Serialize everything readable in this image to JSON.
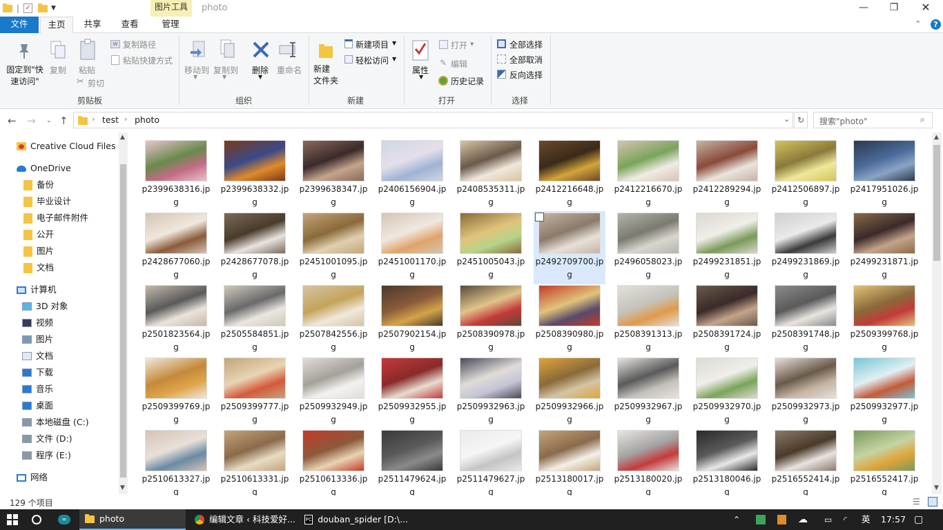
{
  "window": {
    "title": "photo",
    "context_tab": "图片工具",
    "minimize_icon": "minimize-icon",
    "restore_icon": "restore-icon",
    "close_icon": "close-icon"
  },
  "ribbon_tabs": {
    "file": "文件",
    "home": "主页",
    "share": "共享",
    "view": "查看",
    "manage": "管理"
  },
  "ribbon": {
    "pin_label": "固定到\"快速访问\"",
    "copy": "复制",
    "paste": "粘贴",
    "copy_path": "复制路径",
    "paste_shortcut": "粘贴快捷方式",
    "cut": "剪切",
    "clipboard_group": "剪贴板",
    "move_to": "移动到",
    "copy_to": "复制到",
    "delete": "删除",
    "rename": "重命名",
    "organize_group": "组织",
    "new_item": "新建项目",
    "easy_access": "轻松访问",
    "new_folder": "新建\n文件夹",
    "new_group": "新建",
    "properties": "属性",
    "open": "打开",
    "edit": "编辑",
    "history": "历史记录",
    "open_group": "打开",
    "select_all": "全部选择",
    "select_none": "全部取消",
    "invert_selection": "反向选择",
    "select_group": "选择"
  },
  "address": {
    "crumbs": [
      "test",
      "photo"
    ],
    "search_placeholder": "搜索\"photo\""
  },
  "nav_pane": {
    "creative_cloud": "Creative Cloud Files",
    "onedrive": "OneDrive",
    "onedrive_items": [
      "备份",
      "毕业设计",
      "电子邮件附件",
      "公开",
      "图片",
      "文档"
    ],
    "this_pc": "计算机",
    "pc_items": [
      "3D 对象",
      "视频",
      "图片",
      "文档",
      "下载",
      "音乐",
      "桌面",
      "本地磁盘 (C:)",
      "文件 (D:)",
      "程序 (E:)"
    ],
    "network": "网络"
  },
  "files": [
    {
      "name": "p2399638316.jpg",
      "colors": [
        "#e8c4cc",
        "#c46b86",
        "#6a8a4c"
      ]
    },
    {
      "name": "p2399638332.jpg",
      "colors": [
        "#7a3a1a",
        "#e08a2a",
        "#3a4a8a"
      ]
    },
    {
      "name": "p2399638347.jpg",
      "colors": [
        "#8a6a5a",
        "#c4a48c",
        "#3a2a2a"
      ]
    },
    {
      "name": "p2406156904.jpg",
      "colors": [
        "#cfd6e4",
        "#9fb3d4",
        "#e4e0ea"
      ]
    },
    {
      "name": "p2408535311.jpg",
      "colors": [
        "#d8c4a4",
        "#f0e8dc",
        "#6a5a4a"
      ]
    },
    {
      "name": "p2412216648.jpg",
      "colors": [
        "#6a4a2a",
        "#d4a43a",
        "#3a2a1a"
      ]
    },
    {
      "name": "p2412216670.jpg",
      "colors": [
        "#d4c4b4",
        "#f0ece4",
        "#7aa45a"
      ]
    },
    {
      "name": "p2412289294.jpg",
      "colors": [
        "#c4b4a4",
        "#eae4dc",
        "#8a4a3a"
      ]
    },
    {
      "name": "p2412506897.jpg",
      "colors": [
        "#d4c45a",
        "#f0e89a",
        "#8a7a3a"
      ]
    },
    {
      "name": "p2417951026.jpg",
      "colors": [
        "#2a3a4a",
        "#8aa4c4",
        "#4a6a9a"
      ]
    },
    {
      "name": "p2428677060.jpg",
      "colors": [
        "#d4c4b4",
        "#8a5a3a",
        "#f0e8dc"
      ]
    },
    {
      "name": "p2428677078.jpg",
      "colors": [
        "#7a6a5a",
        "#e8e4e0",
        "#4a3a2a"
      ]
    },
    {
      "name": "p2451001095.jpg",
      "colors": [
        "#c4a47a",
        "#e0d0b0",
        "#8a6a3a"
      ]
    },
    {
      "name": "p2451001170.jpg",
      "colors": [
        "#d4c4b4",
        "#e0a46a",
        "#f0e8e0"
      ]
    },
    {
      "name": "p2451005043.jpg",
      "colors": [
        "#8a6a3a",
        "#b4d48a",
        "#e0c47a"
      ]
    },
    {
      "name": "p2492709700.jpg",
      "colors": [
        "#c4b4a4",
        "#e8e0d8",
        "#8a7a6a"
      ]
    },
    {
      "name": "p2496058023.jpg",
      "colors": [
        "#b4b4ac",
        "#dad6cf",
        "#7a7a70"
      ]
    },
    {
      "name": "p2499231851.jpg",
      "colors": [
        "#dad8d0",
        "#7a9a5a",
        "#f0eee8"
      ]
    },
    {
      "name": "p2499231869.jpg",
      "colors": [
        "#cfcfcf",
        "#3a3a3a",
        "#eaeaea"
      ]
    },
    {
      "name": "p2499231871.jpg",
      "colors": [
        "#8a6a4a",
        "#c4a48a",
        "#3a2a2a"
      ]
    },
    {
      "name": "p2501823564.jpg",
      "colors": [
        "#c4b8aa",
        "#eae4dc",
        "#5a5a5a"
      ]
    },
    {
      "name": "p2505584851.jpg",
      "colors": [
        "#cfc8bc",
        "#eae6e0",
        "#6a6a6a"
      ]
    },
    {
      "name": "p2507842556.jpg",
      "colors": [
        "#d4c4a4",
        "#f0e8dc",
        "#c4a45a"
      ]
    },
    {
      "name": "p2507902154.jpg",
      "colors": [
        "#4a3a2a",
        "#d4a44a",
        "#8a5a3a"
      ]
    },
    {
      "name": "p2508390978.jpg",
      "colors": [
        "#5a4a3a",
        "#c43a3a",
        "#e0c48a"
      ]
    },
    {
      "name": "p2508390980.jpg",
      "colors": [
        "#c43a2a",
        "#5a4a6a",
        "#e0c47a"
      ]
    },
    {
      "name": "p2508391313.jpg",
      "colors": [
        "#e4e0d8",
        "#e09a4a",
        "#c4c4bc"
      ]
    },
    {
      "name": "p2508391724.jpg",
      "colors": [
        "#6a5a4a",
        "#c4a48a",
        "#3a2a2a"
      ]
    },
    {
      "name": "p2508391748.jpg",
      "colors": [
        "#8a8a8a",
        "#e8e4e0",
        "#5a5a5a"
      ]
    },
    {
      "name": "p2509399768.jpg",
      "colors": [
        "#e0c47a",
        "#c43a3a",
        "#8a6a3a"
      ]
    },
    {
      "name": "p2509399769.jpg",
      "colors": [
        "#f0e8dc",
        "#e0a44a",
        "#c48a3a"
      ]
    },
    {
      "name": "p2509399777.jpg",
      "colors": [
        "#c4a47a",
        "#d45a3a",
        "#e8d4b4"
      ]
    },
    {
      "name": "p2509932949.jpg",
      "colors": [
        "#e0dcd8",
        "#f4f2f0",
        "#a4a09a"
      ]
    },
    {
      "name": "p2509932955.jpg",
      "colors": [
        "#c43a3a",
        "#e8dcd0",
        "#8a2a2a"
      ]
    },
    {
      "name": "p2509932963.jpg",
      "colors": [
        "#4a4a5a",
        "#c4c4d4",
        "#e0dcd8"
      ]
    },
    {
      "name": "p2509932966.jpg",
      "colors": [
        "#e0a43a",
        "#d4c4a4",
        "#8a6a3a"
      ]
    },
    {
      "name": "p2509932967.jpg",
      "colors": [
        "#e8e4e0",
        "#c4c0bc",
        "#5a5a5a"
      ]
    },
    {
      "name": "p2509932970.jpg",
      "colors": [
        "#dcdad4",
        "#7aa45a",
        "#f0eeea"
      ]
    },
    {
      "name": "p2509932973.jpg",
      "colors": [
        "#e8e0d8",
        "#c4b4a4",
        "#6a5a4a"
      ]
    },
    {
      "name": "p2509932977.jpg",
      "colors": [
        "#7ac4d4",
        "#c45a3a",
        "#e0f0f4"
      ]
    },
    {
      "name": "p2510613327.jpg",
      "colors": [
        "#d4c4b4",
        "#6a8aa4",
        "#e8e0d8"
      ]
    },
    {
      "name": "p2510613331.jpg",
      "colors": [
        "#c4a47a",
        "#e8dcc4",
        "#8a6a4a"
      ]
    },
    {
      "name": "p2510613336.jpg",
      "colors": [
        "#c43a2a",
        "#e8d4b4",
        "#8a5a3a"
      ]
    },
    {
      "name": "p2511479624.jpg",
      "colors": [
        "#3a3a3a",
        "#8a8a8a",
        "#5a5a5a"
      ]
    },
    {
      "name": "p2511479627.jpg",
      "colors": [
        "#eaeaea",
        "#c4c4c4",
        "#f6f6f6"
      ]
    },
    {
      "name": "p2513180017.jpg",
      "colors": [
        "#c4a47a",
        "#f4f0e8",
        "#8a6a4a"
      ]
    },
    {
      "name": "p2513180020.jpg",
      "colors": [
        "#e8e4e0",
        "#c43a3a",
        "#a4a4a4"
      ]
    },
    {
      "name": "p2513180046.jpg",
      "colors": [
        "#2a2a2a",
        "#e8e8e8",
        "#5a5a5a"
      ]
    },
    {
      "name": "p2516552414.jpg",
      "colors": [
        "#8a7a6a",
        "#e8e4e0",
        "#4a3a2a"
      ]
    },
    {
      "name": "p2516552417.jpg",
      "colors": [
        "#7a9a5a",
        "#e0a43a",
        "#c4d4a4"
      ]
    }
  ],
  "selected_index": 15,
  "status": {
    "count": "129 个项目"
  },
  "taskbar": {
    "explorer": "photo",
    "chrome": "编辑文章 ‹ 科技爱好...",
    "pycharm": "douban_spider [D:\\...",
    "ime": "英",
    "time": "17:57"
  },
  "colors": {
    "accent": "#1979ca",
    "tools_tab": "#f7efb4",
    "selection": "#d9e9fb",
    "taskbar": "#202020"
  }
}
